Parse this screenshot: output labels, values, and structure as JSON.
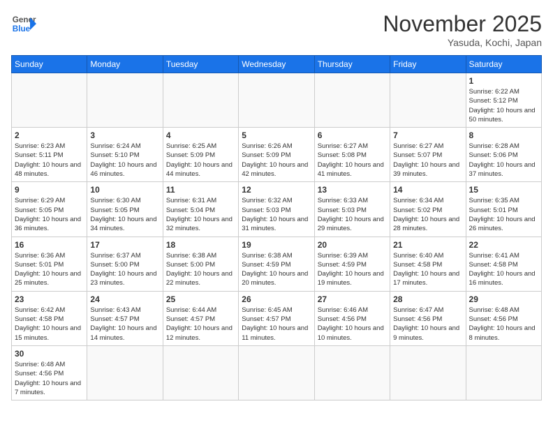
{
  "header": {
    "logo_general": "General",
    "logo_blue": "Blue",
    "month_title": "November 2025",
    "location": "Yasuda, Kochi, Japan"
  },
  "weekdays": [
    "Sunday",
    "Monday",
    "Tuesday",
    "Wednesday",
    "Thursday",
    "Friday",
    "Saturday"
  ],
  "weeks": [
    [
      null,
      null,
      null,
      null,
      null,
      null,
      {
        "day": "1",
        "sunrise": "6:22 AM",
        "sunset": "5:12 PM",
        "daylight": "10 hours and 50 minutes."
      }
    ],
    [
      {
        "day": "2",
        "sunrise": "6:23 AM",
        "sunset": "5:11 PM",
        "daylight": "10 hours and 48 minutes."
      },
      {
        "day": "3",
        "sunrise": "6:24 AM",
        "sunset": "5:10 PM",
        "daylight": "10 hours and 46 minutes."
      },
      {
        "day": "4",
        "sunrise": "6:25 AM",
        "sunset": "5:09 PM",
        "daylight": "10 hours and 44 minutes."
      },
      {
        "day": "5",
        "sunrise": "6:26 AM",
        "sunset": "5:09 PM",
        "daylight": "10 hours and 42 minutes."
      },
      {
        "day": "6",
        "sunrise": "6:27 AM",
        "sunset": "5:08 PM",
        "daylight": "10 hours and 41 minutes."
      },
      {
        "day": "7",
        "sunrise": "6:27 AM",
        "sunset": "5:07 PM",
        "daylight": "10 hours and 39 minutes."
      },
      {
        "day": "8",
        "sunrise": "6:28 AM",
        "sunset": "5:06 PM",
        "daylight": "10 hours and 37 minutes."
      }
    ],
    [
      {
        "day": "9",
        "sunrise": "6:29 AM",
        "sunset": "5:05 PM",
        "daylight": "10 hours and 36 minutes."
      },
      {
        "day": "10",
        "sunrise": "6:30 AM",
        "sunset": "5:05 PM",
        "daylight": "10 hours and 34 minutes."
      },
      {
        "day": "11",
        "sunrise": "6:31 AM",
        "sunset": "5:04 PM",
        "daylight": "10 hours and 32 minutes."
      },
      {
        "day": "12",
        "sunrise": "6:32 AM",
        "sunset": "5:03 PM",
        "daylight": "10 hours and 31 minutes."
      },
      {
        "day": "13",
        "sunrise": "6:33 AM",
        "sunset": "5:03 PM",
        "daylight": "10 hours and 29 minutes."
      },
      {
        "day": "14",
        "sunrise": "6:34 AM",
        "sunset": "5:02 PM",
        "daylight": "10 hours and 28 minutes."
      },
      {
        "day": "15",
        "sunrise": "6:35 AM",
        "sunset": "5:01 PM",
        "daylight": "10 hours and 26 minutes."
      }
    ],
    [
      {
        "day": "16",
        "sunrise": "6:36 AM",
        "sunset": "5:01 PM",
        "daylight": "10 hours and 25 minutes."
      },
      {
        "day": "17",
        "sunrise": "6:37 AM",
        "sunset": "5:00 PM",
        "daylight": "10 hours and 23 minutes."
      },
      {
        "day": "18",
        "sunrise": "6:38 AM",
        "sunset": "5:00 PM",
        "daylight": "10 hours and 22 minutes."
      },
      {
        "day": "19",
        "sunrise": "6:38 AM",
        "sunset": "4:59 PM",
        "daylight": "10 hours and 20 minutes."
      },
      {
        "day": "20",
        "sunrise": "6:39 AM",
        "sunset": "4:59 PM",
        "daylight": "10 hours and 19 minutes."
      },
      {
        "day": "21",
        "sunrise": "6:40 AM",
        "sunset": "4:58 PM",
        "daylight": "10 hours and 17 minutes."
      },
      {
        "day": "22",
        "sunrise": "6:41 AM",
        "sunset": "4:58 PM",
        "daylight": "10 hours and 16 minutes."
      }
    ],
    [
      {
        "day": "23",
        "sunrise": "6:42 AM",
        "sunset": "4:58 PM",
        "daylight": "10 hours and 15 minutes."
      },
      {
        "day": "24",
        "sunrise": "6:43 AM",
        "sunset": "4:57 PM",
        "daylight": "10 hours and 14 minutes."
      },
      {
        "day": "25",
        "sunrise": "6:44 AM",
        "sunset": "4:57 PM",
        "daylight": "10 hours and 12 minutes."
      },
      {
        "day": "26",
        "sunrise": "6:45 AM",
        "sunset": "4:57 PM",
        "daylight": "10 hours and 11 minutes."
      },
      {
        "day": "27",
        "sunrise": "6:46 AM",
        "sunset": "4:56 PM",
        "daylight": "10 hours and 10 minutes."
      },
      {
        "day": "28",
        "sunrise": "6:47 AM",
        "sunset": "4:56 PM",
        "daylight": "10 hours and 9 minutes."
      },
      {
        "day": "29",
        "sunrise": "6:48 AM",
        "sunset": "4:56 PM",
        "daylight": "10 hours and 8 minutes."
      }
    ],
    [
      {
        "day": "30",
        "sunrise": "6:48 AM",
        "sunset": "4:56 PM",
        "daylight": "10 hours and 7 minutes."
      },
      null,
      null,
      null,
      null,
      null,
      null
    ]
  ]
}
